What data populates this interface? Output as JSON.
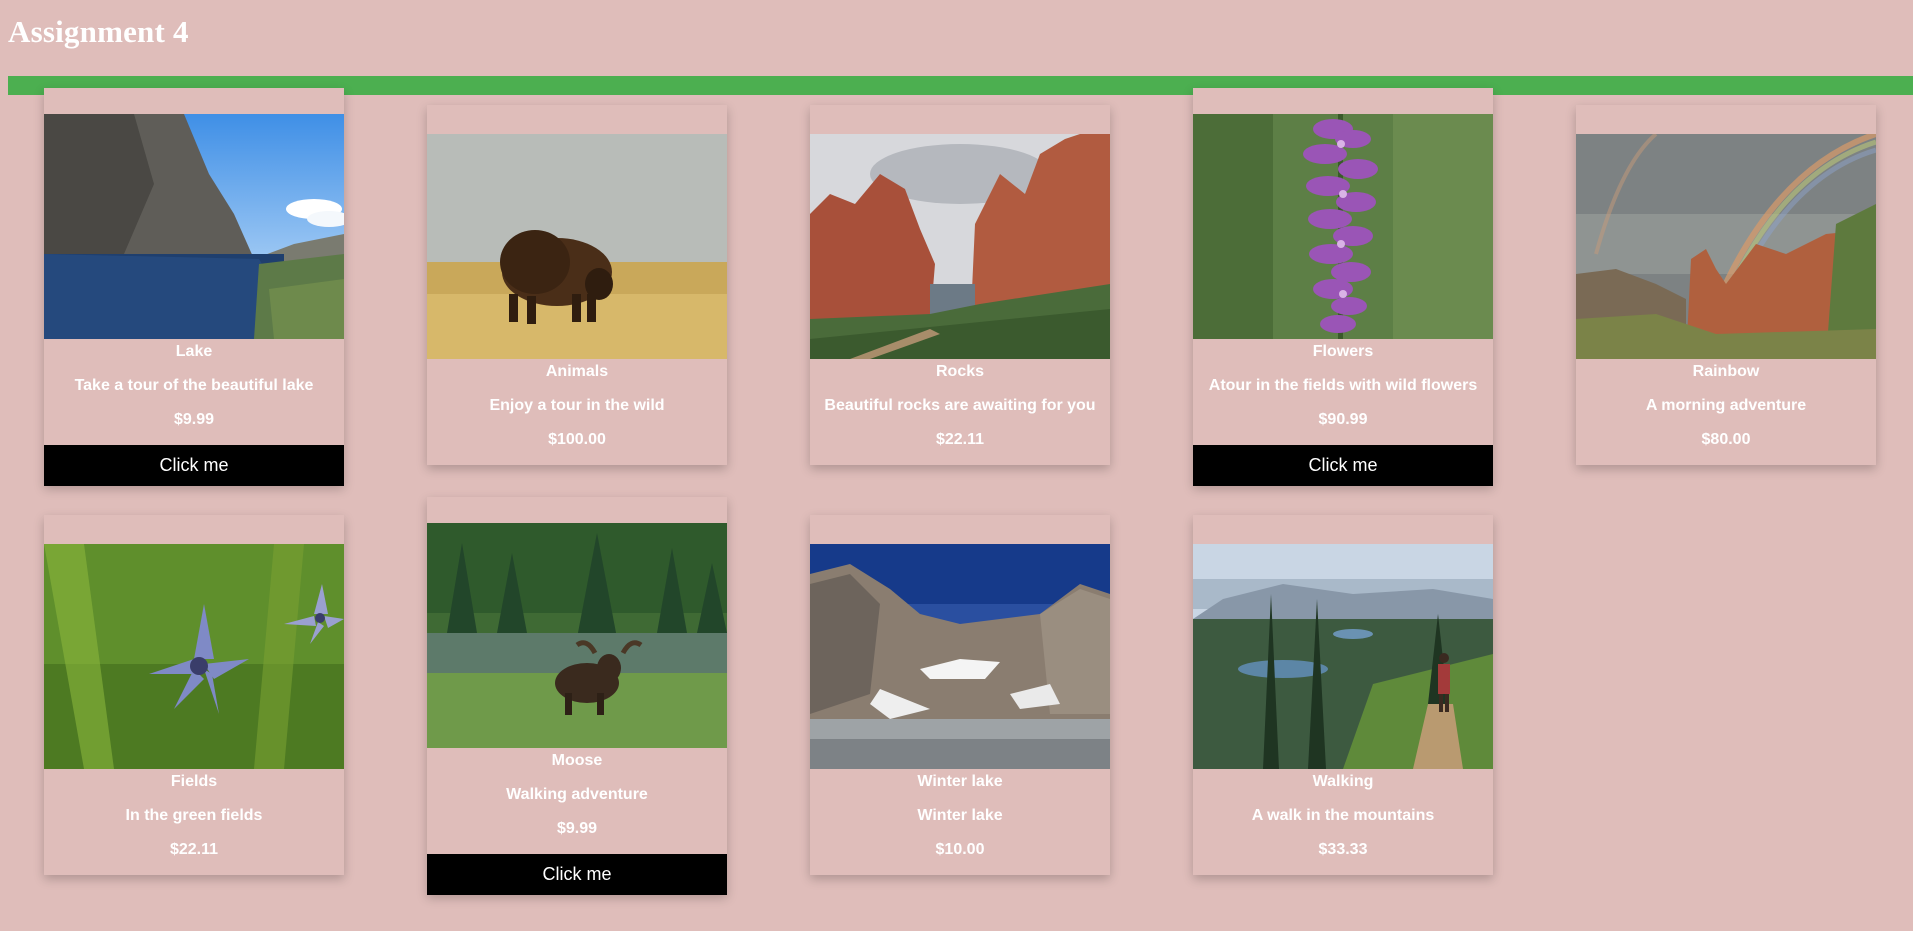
{
  "page": {
    "title": "Assignment 4"
  },
  "colors": {
    "background": "#dfbdba",
    "bar": "#4caf50",
    "button": "#000000",
    "text": "#ffffff"
  },
  "cards": [
    {
      "name": "Lake",
      "desc": "Take a tour of the beautiful lake",
      "price": "$9.99",
      "button": "Click me",
      "image": "lake-photo"
    },
    {
      "name": "Animals",
      "desc": "Enjoy a tour in the wild",
      "price": "$100.00",
      "image": "bison-photo"
    },
    {
      "name": "Rocks",
      "desc": "Beautiful rocks are awaiting for you",
      "price": "$22.11",
      "image": "red-rocks-photo"
    },
    {
      "name": "Flowers",
      "desc": "Atour in the fields with wild flowers",
      "price": "$90.99",
      "button": "Click me",
      "image": "purple-flowers-photo"
    },
    {
      "name": "Rainbow",
      "desc": "A morning adventure",
      "price": "$80.00",
      "image": "rainbow-canyon-photo"
    },
    {
      "name": "Fields",
      "desc": "In the green fields",
      "price": "$22.11",
      "image": "blue-flower-photo"
    },
    {
      "name": "Moose",
      "desc": "Walking adventure",
      "price": "$9.99",
      "button": "Click me",
      "image": "moose-photo"
    },
    {
      "name": "Winter lake",
      "desc": "Winter lake",
      "price": "$10.00",
      "image": "winter-lake-photo"
    },
    {
      "name": "Walking",
      "desc": "A walk in the mountains",
      "price": "$33.33",
      "image": "hiking-trail-photo"
    }
  ]
}
